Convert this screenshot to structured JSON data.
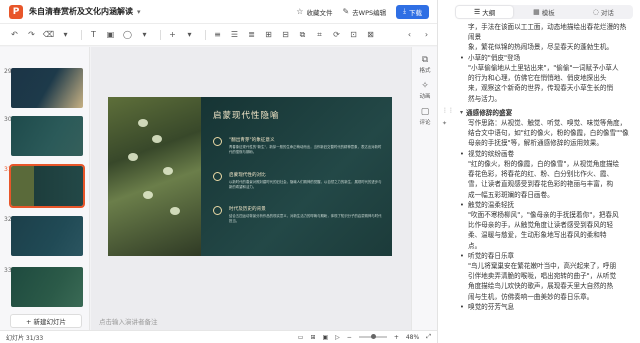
{
  "titlebar": {
    "app_logo": "P",
    "doc_title": "朱自清春赏析及文化内涵解读",
    "favorite_label": "收藏文件",
    "wps_edit_label": "去WPS编辑",
    "download_label": "下载"
  },
  "slides_panel": {
    "thumbs": [
      {
        "num": "29"
      },
      {
        "num": "30"
      },
      {
        "num": "31"
      },
      {
        "num": "32"
      },
      {
        "num": "33"
      }
    ],
    "new_slide_label": "+ 新建幻灯片"
  },
  "slide": {
    "title": "启蒙现代性隐喻",
    "items": [
      {
        "sub": "\"翻出青芽\"的象征意义",
        "body": "青春象征现代性的\"新生\"，新芽一般的生命正萌动而出，当作新旧交替时代的精神意象，表达出对新时代的憧憬与期盼。"
      },
      {
        "sub": "启蒙现代性的对比",
        "body": "以新时代的春景对照封建时代的旧社会，隐喻人们精神的觉醒，以自然之力的新生，展现时代的进步与新的希望和活力。"
      },
      {
        "sub": "时代及历史的背景",
        "body": "结合五四运动背景分析作品的现实意义，对新生活力的呼唤与期盼，体现了知识分子的启蒙精神与时代担当。"
      }
    ]
  },
  "notes_placeholder": "点击输入演讲者备注",
  "rail": {
    "format_label": "格式",
    "animation_label": "动画",
    "comment_label": "评论"
  },
  "statusbar": {
    "slide_counter": "幻灯片 31/33",
    "zoom": "48%"
  },
  "ai_panel": {
    "tabs": [
      {
        "label": "大纲",
        "icon": "outline-icon"
      },
      {
        "label": "模板",
        "icon": "template-icon"
      },
      {
        "label": "对话",
        "icon": "chat-icon"
      }
    ],
    "lines": [
      {
        "kind": "para",
        "text": "字，手法在该面以工工面，动态地描绘出春花烂漫的热闹景"
      },
      {
        "kind": "para",
        "text": "象，繁花似锦的热闹场景，尽显春天的蓬勃生机。"
      },
      {
        "kind": "bullet",
        "text": "小草的\"俏皮\"登场"
      },
      {
        "kind": "para",
        "text": "\"小草偷偷地从土里钻出来\"，\"偷偷\"一词赋予小草人"
      },
      {
        "kind": "para",
        "text": "的行为和心理，仿佛它在悄悄地、俏皮地探出头"
      },
      {
        "kind": "para",
        "text": "来，观察这个新奇的世界，传现春天小草生长的悄"
      },
      {
        "kind": "para",
        "text": "然与活力。"
      },
      {
        "kind": "gap"
      },
      {
        "kind": "head",
        "text": "通感修辞的盛宴"
      },
      {
        "kind": "para",
        "text": "写作思路：从视觉、触觉、听觉、嗅觉、味觉等角度，"
      },
      {
        "kind": "para",
        "text": "结合文中语句，如\"红的像火，粉的像霞，白的像雪\"\"像"
      },
      {
        "kind": "para",
        "text": "母亲的手抚摸\"等，解析通感修辞的运用效果。"
      },
      {
        "kind": "bullet",
        "text": "视觉的缤纷画卷"
      },
      {
        "kind": "para",
        "text": "\"红的像火，粉的像霞，白的像雪\"，从视觉角度描绘"
      },
      {
        "kind": "para",
        "text": "春花色彩，将春花的红、粉、白分别比作火、霞、"
      },
      {
        "kind": "para",
        "text": "雪，让读者直观感受到春花色彩的艳丽与丰富，构"
      },
      {
        "kind": "para",
        "text": "成一幅五彩斑斓的春日画卷。"
      },
      {
        "kind": "bullet",
        "text": "触觉的温柔轻抚"
      },
      {
        "kind": "para",
        "text": "\"吹面不寒杨柳风\"，\"像母亲的手抚摸着你\"，把春风"
      },
      {
        "kind": "para",
        "text": "比作母亲的手，从触觉角度让读者感受到春风的轻"
      },
      {
        "kind": "para",
        "text": "柔、温暖与慈爱，生动形象地写出春风的柔和特"
      },
      {
        "kind": "para",
        "text": "点。"
      },
      {
        "kind": "bullet",
        "text": "听觉的春日乐章"
      },
      {
        "kind": "para",
        "text": "\"鸟儿将窠巢安在繁花嫩叶当中，高兴起来了，呼朋"
      },
      {
        "kind": "para",
        "text": "引伴地卖弄清脆的喉咙，唱出宛转的曲子\"，从听觉"
      },
      {
        "kind": "para",
        "text": "角度描绘鸟儿欢快的歌声，展现春天里大自然的热"
      },
      {
        "kind": "para",
        "text": "闹与生机，仿佛奏响一曲美妙的春日乐章。"
      },
      {
        "kind": "bullet",
        "text": "嗅觉的芬芳气息"
      }
    ]
  }
}
